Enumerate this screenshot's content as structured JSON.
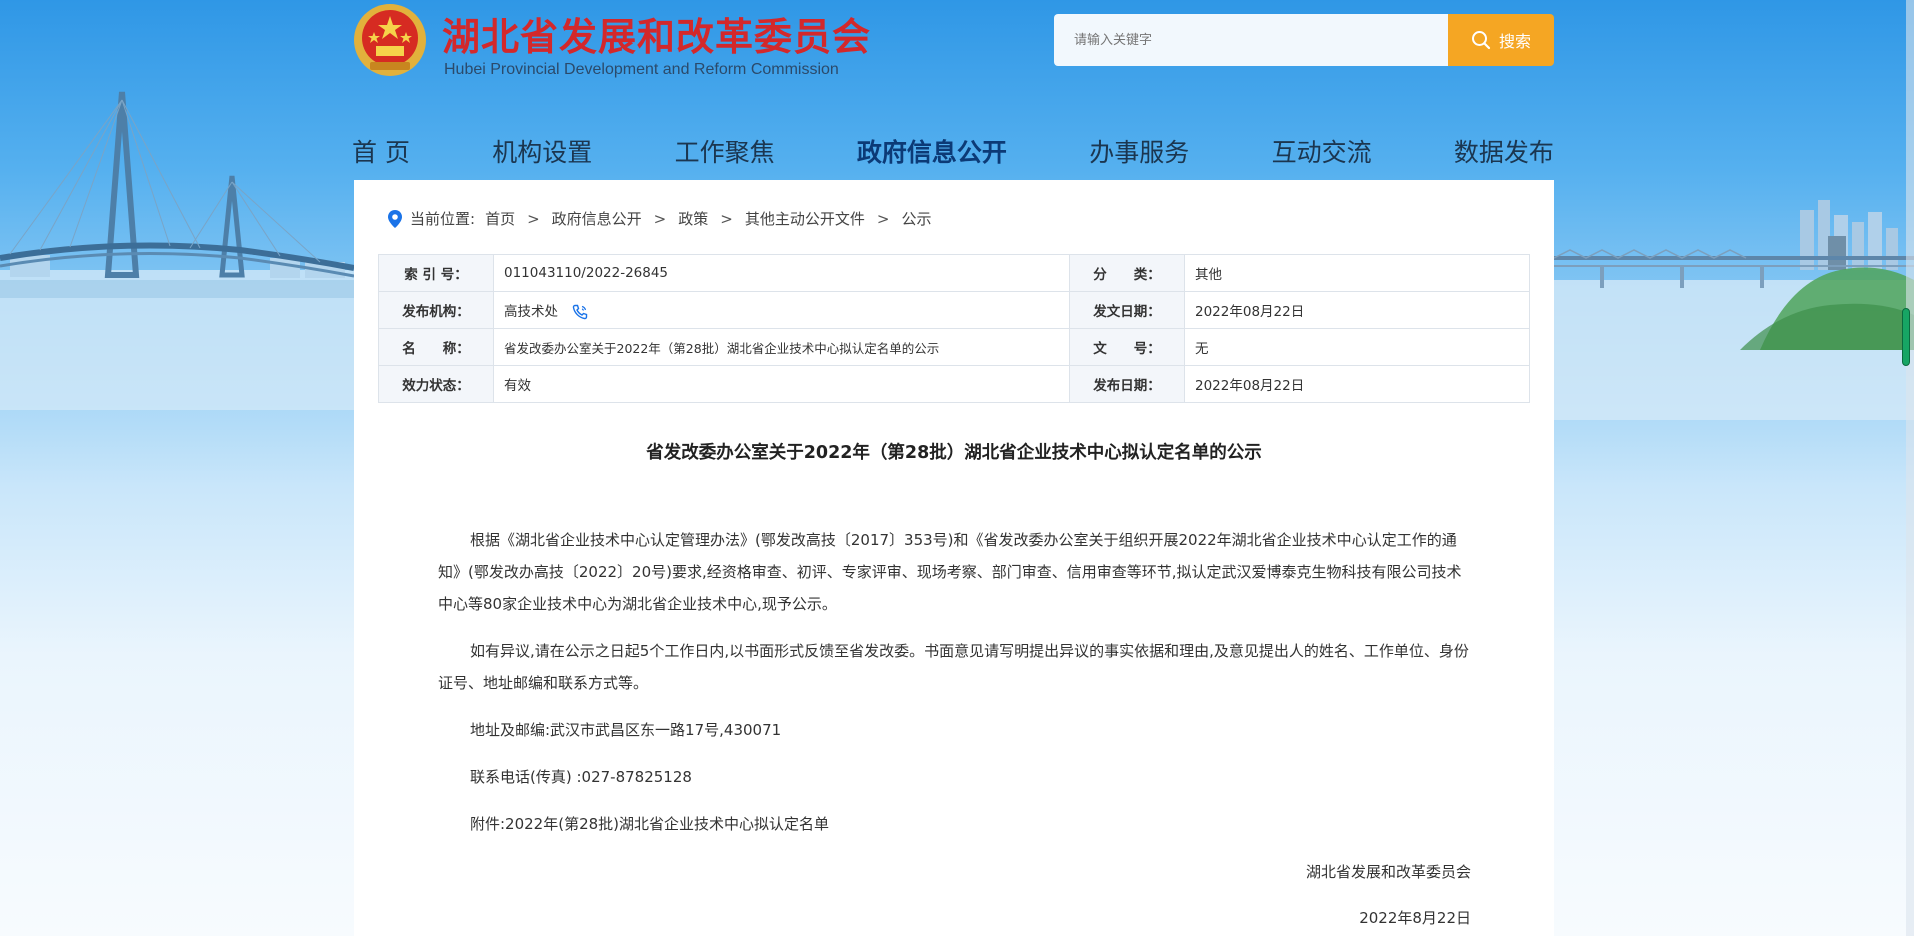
{
  "header": {
    "title": "湖北省发展和改革委员会",
    "subtitle": "Hubei Provincial Development and Reform Commission",
    "search_placeholder": "请输入关键字",
    "search_button": "搜索"
  },
  "nav": {
    "items": [
      "首 页",
      "机构设置",
      "工作聚焦",
      "政府信息公开",
      "办事服务",
      "互动交流",
      "数据发布"
    ],
    "active": "政府信息公开"
  },
  "breadcrumb": {
    "label": "当前位置:",
    "items": [
      "首页",
      "政府信息公开",
      "政策",
      "其他主动公开文件",
      "公示"
    ],
    "separator": ">"
  },
  "meta": {
    "index_label": "索 引 号：",
    "index_value": "011043110/2022-26845",
    "category_label": "分　　类：",
    "category_value": "其他",
    "publisher_label": "发布机构：",
    "publisher_value": "高技术处",
    "issue_date_label": "发文日期：",
    "issue_date_value": "2022年08月22日",
    "name_label": "名　　称：",
    "name_value": "省发改委办公室关于2022年（第28批）湖北省企业技术中心拟认定名单的公示",
    "doc_no_label": "文　　号：",
    "doc_no_value": "无",
    "status_label": "效力状态：",
    "status_value": "有效",
    "publish_date_label": "发布日期：",
    "publish_date_value": "2022年08月22日"
  },
  "document": {
    "title": "省发改委办公室关于2022年（第28批）湖北省企业技术中心拟认定名单的公示",
    "paragraphs": [
      "根据《湖北省企业技术中心认定管理办法》(鄂发改高技〔2017〕353号)和《省发改委办公室关于组织开展2022年湖北省企业技术中心认定工作的通知》(鄂发改办高技〔2022〕20号)要求,经资格审查、初评、专家评审、现场考察、部门审查、信用审查等环节,拟认定武汉爱博泰克生物科技有限公司技术中心等80家企业技术中心为湖北省企业技术中心,现予公示。",
      "如有异议,请在公示之日起5个工作日内,以书面形式反馈至省发改委。书面意见请写明提出异议的事实依据和理由,及意见提出人的姓名、工作单位、身份证号、地址邮编和联系方式等。",
      "地址及邮编:武汉市武昌区东一路17号,430071",
      "联系电话(传真) :027-87825128",
      "附件:2022年(第28批)湖北省企业技术中心拟认定名单"
    ],
    "signature": "湖北省发展和改革委员会",
    "date": "2022年8月22日"
  },
  "colors": {
    "brand_red": "#d3282b",
    "search_button": "#f5a623",
    "nav_text": "#1b3650",
    "location_icon": "#1a73e8"
  },
  "icons": [
    "national-emblem-icon",
    "search-icon",
    "location-pin-icon",
    "phone-icon"
  ]
}
